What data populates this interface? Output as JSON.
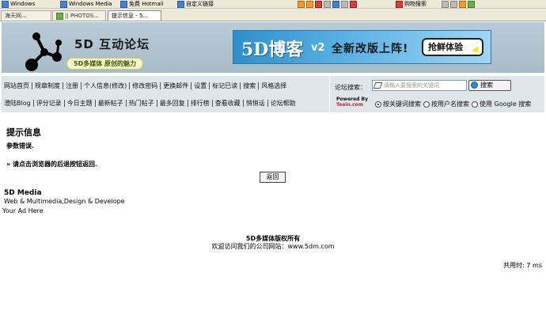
{
  "browser": {
    "links": [
      {
        "label": "Windows",
        "icon": "link-icon"
      },
      {
        "label": "Windows Media",
        "icon": "link-icon"
      },
      {
        "label": "免费 Hotmail",
        "icon": "link-icon"
      },
      {
        "label": "自定义链接",
        "icon": "link-icon"
      },
      {
        "label": "购物搜索",
        "icon": "shopping-icon"
      }
    ],
    "tabs": [
      {
        "label": "海天网..."
      },
      {
        "label": "|| PHOTOS..."
      },
      {
        "label": "提示信息 - 5..."
      }
    ]
  },
  "header": {
    "site_title": "5D 互动论坛",
    "slogan": "5D多媒体 原创的魅力",
    "banner": {
      "brand": "5D博客",
      "version": "v2",
      "promo": "全新改版上阵!",
      "button": "抢鲜体验"
    }
  },
  "nav": {
    "row1": [
      "网站首页",
      "规章制度",
      "注册",
      "个人信息(修改)",
      "修改密码",
      "更换邮件",
      "设置",
      "标记已读",
      "搜索",
      "风格选择"
    ],
    "row2": [
      "澄陆Blog",
      "评分记录",
      "今日主题",
      "最新帖子",
      "热门帖子",
      "最多回复",
      "排行榜",
      "查看收藏",
      "悄悄话",
      "论坛帮助"
    ]
  },
  "search": {
    "label": "论坛搜索：",
    "placeholder": "请输入要搜索的关键词",
    "button": "搜索",
    "powered_by": "Powered By",
    "powered_brand": "Teein.com",
    "options": [
      {
        "label": "按关键词搜索",
        "selected": true
      },
      {
        "label": "按用户名搜索",
        "selected": false
      },
      {
        "label": "使用 Google 搜索",
        "selected": false
      }
    ]
  },
  "message": {
    "title": "提示信息",
    "error": "参数错误.",
    "hint": "» 请点击浏览器的后退按钮返回.",
    "back_button": "返回"
  },
  "sponsor": {
    "name": "5D Media",
    "description": "Web & Multimedia,Design & Develope",
    "ad": "Your Ad Here"
  },
  "footer": {
    "copyright": "5D多媒体版权所有",
    "visit": "欢迎访问我们的公司网站：www.5dm.com",
    "elapsed": "共用时: 7 ms"
  }
}
